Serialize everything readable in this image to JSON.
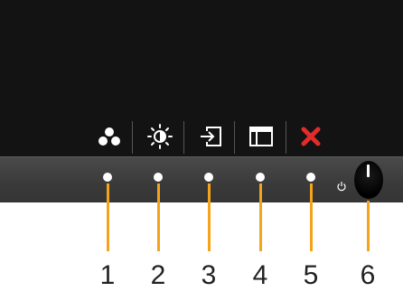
{
  "osd": {
    "buttons": [
      {
        "icon": "preset-modes-icon",
        "number": "1"
      },
      {
        "icon": "brightness-contrast-icon",
        "number": "2"
      },
      {
        "icon": "input-source-icon",
        "number": "3"
      },
      {
        "icon": "menu-icon",
        "number": "4"
      },
      {
        "icon": "exit-icon",
        "number": "5"
      },
      {
        "icon": "power-icon",
        "number": "6"
      }
    ]
  },
  "colors": {
    "leader_line": "#f5a31a",
    "exit": "#e32b2b",
    "screen": "#131313",
    "bar": "#3f3f3f"
  }
}
